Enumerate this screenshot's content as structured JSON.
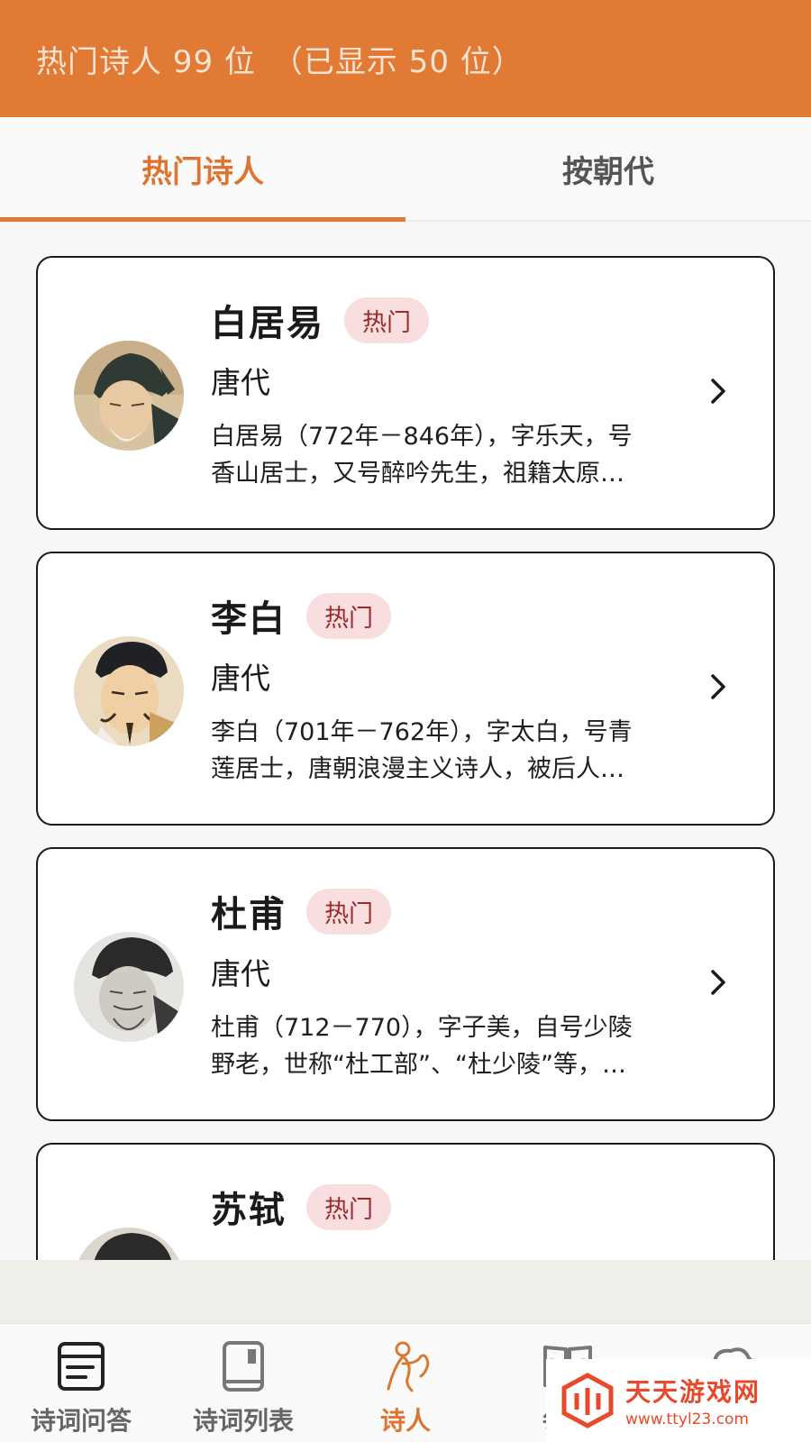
{
  "header": {
    "title": "热门诗人 99 位　（已显示 50 位）"
  },
  "tabs": [
    {
      "label": "热门诗人",
      "active": true
    },
    {
      "label": "按朝代",
      "active": false
    }
  ],
  "poets": [
    {
      "name": "白居易",
      "badge": "热门",
      "dynasty": "唐代",
      "desc_line1": "白居易（772年－846年），字乐天，号",
      "desc_line2": "香山居士，又号醉吟先生，祖籍太原…"
    },
    {
      "name": "李白",
      "badge": "热门",
      "dynasty": "唐代",
      "desc_line1": "李白（701年－762年），字太白，号青",
      "desc_line2": "莲居士，唐朝浪漫主义诗人，被后人…"
    },
    {
      "name": "杜甫",
      "badge": "热门",
      "dynasty": "唐代",
      "desc_line1": "杜甫（712－770），字子美，自号少陵",
      "desc_line2": "野老，世称“杜工部”、“杜少陵”等，…"
    },
    {
      "name": "苏轼",
      "badge": "热门",
      "dynasty": "",
      "desc_line1": "",
      "desc_line2": ""
    }
  ],
  "bottom_nav": [
    {
      "label": "诗词问答",
      "icon": "qa-card-icon",
      "active": false
    },
    {
      "label": "诗词列表",
      "icon": "book-icon",
      "active": false
    },
    {
      "label": "诗人",
      "icon": "poet-figure-icon",
      "active": true
    },
    {
      "label": "每日",
      "icon": "open-book-icon",
      "active": false
    },
    {
      "label": "",
      "icon": "cloud-icon",
      "active": false
    }
  ],
  "watermark": {
    "name": "天天游戏网",
    "url": "www.ttyl23.com"
  },
  "colors": {
    "accent": "#e07a35",
    "badge_bg": "#f8dede",
    "badge_text": "#9b2a2a"
  }
}
